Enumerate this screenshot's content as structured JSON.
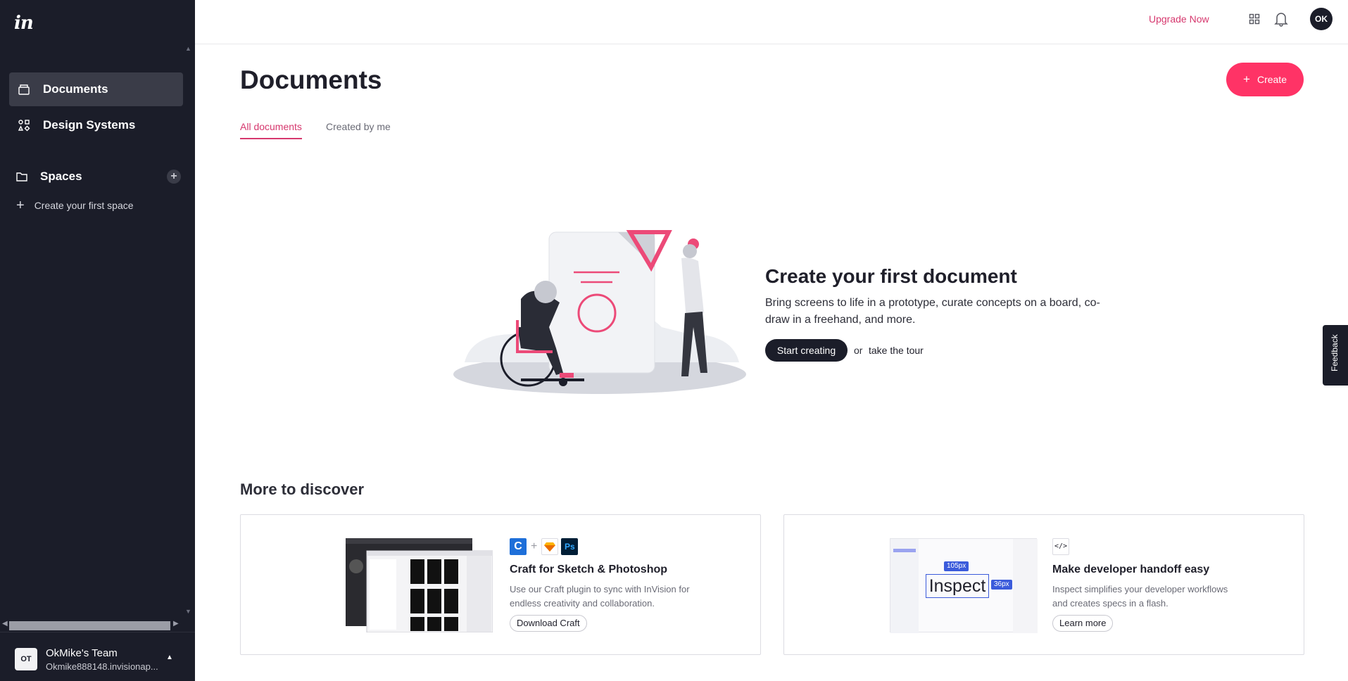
{
  "app": {
    "logo_text": "in"
  },
  "sidebar": {
    "items": [
      {
        "label": "Documents",
        "icon": "documents-icon",
        "active": true
      },
      {
        "label": "Design Systems",
        "icon": "design-systems-icon",
        "active": false
      }
    ],
    "spaces": {
      "label": "Spaces",
      "add_icon": "plus-icon"
    },
    "create_space_label": "Create your first space",
    "team": {
      "avatar": "OT",
      "name": "OkMike's Team",
      "url": "Okmike888148.invisionap..."
    }
  },
  "topbar": {
    "upgrade_label": "Upgrade Now",
    "apps_icon": "grid-icon",
    "notifications_icon": "bell-icon",
    "user_initials": "OK"
  },
  "main": {
    "title": "Documents",
    "create_label": "Create",
    "tabs": [
      {
        "label": "All documents",
        "active": true
      },
      {
        "label": "Created by me",
        "active": false
      }
    ],
    "empty_state": {
      "title": "Create your first document",
      "description": "Bring screens to life in a prototype, curate concepts on a board, co-draw in a freehand, and more.",
      "start_label": "Start creating",
      "or_label": "or",
      "tour_label": "take the tour"
    },
    "discover": {
      "title": "More to discover",
      "cards": [
        {
          "title": "Craft for Sketch & Photoshop",
          "description": "Use our Craft plugin to sync with InVision for endless creativity and collaboration.",
          "button": "Download Craft",
          "icons": [
            "craft-icon",
            "sketch-icon",
            "photoshop-icon"
          ],
          "plus": "+",
          "ps_text": "Ps"
        },
        {
          "title": "Make developer handoff easy",
          "description": "Inspect simplifies your developer workflows and creates specs in a flash.",
          "button": "Learn more",
          "icons": [
            "code-icon"
          ],
          "inspect_text": "Inspect",
          "width_tag": "105px",
          "height_tag": "36px"
        }
      ]
    }
  },
  "feedback_label": "Feedback",
  "colors": {
    "brand_pink": "#ff3366",
    "sidebar_bg": "#1b1d29",
    "link_pink": "#d6386e"
  }
}
